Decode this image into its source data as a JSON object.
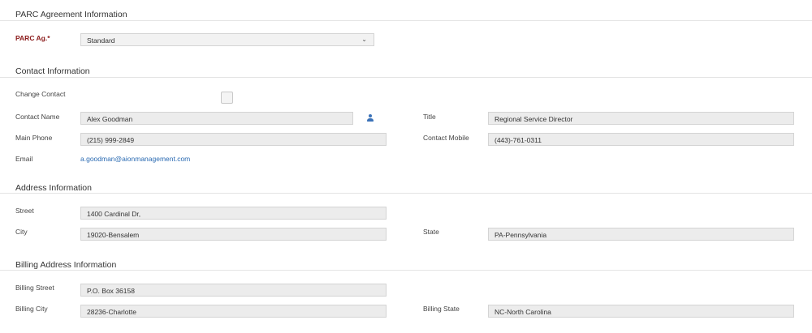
{
  "parc_section": {
    "title": "PARC Agreement Information",
    "parc_ag_label": "PARC Ag.*",
    "parc_ag_value": "Standard"
  },
  "contact_section": {
    "title": "Contact Information",
    "change_contact_label": "Change Contact",
    "change_contact_checked": false,
    "contact_name_label": "Contact Name",
    "contact_name_value": "Alex Goodman",
    "title_label": "Title",
    "title_value": "Regional Service Director",
    "main_phone_label": "Main Phone",
    "main_phone_value": "(215) 999-2849",
    "contact_mobile_label": "Contact Mobile",
    "contact_mobile_value": "(443)-761-0311",
    "email_label": "Email",
    "email_value": "a.goodman@aionmanagement.com"
  },
  "address_section": {
    "title": "Address Information",
    "street_label": "Street",
    "street_value": "1400 Cardinal Dr,",
    "city_label": "City",
    "city_value": "19020-Bensalem",
    "state_label": "State",
    "state_value": "PA-Pennsylvania"
  },
  "billing_section": {
    "title": "Billing Address Information",
    "street_label": "Billing Street",
    "street_value": "P.O. Box 36158",
    "city_label": "Billing City",
    "city_value": "28236-Charlotte",
    "state_label": "Billing State",
    "state_value": "NC-North Carolina"
  },
  "icons": {
    "contact_lookup": "user-icon",
    "dropdown": "chevron-down-icon"
  },
  "colors": {
    "required_label": "#8b1a1a",
    "link": "#2a6ab2",
    "field_background": "#ececec"
  }
}
